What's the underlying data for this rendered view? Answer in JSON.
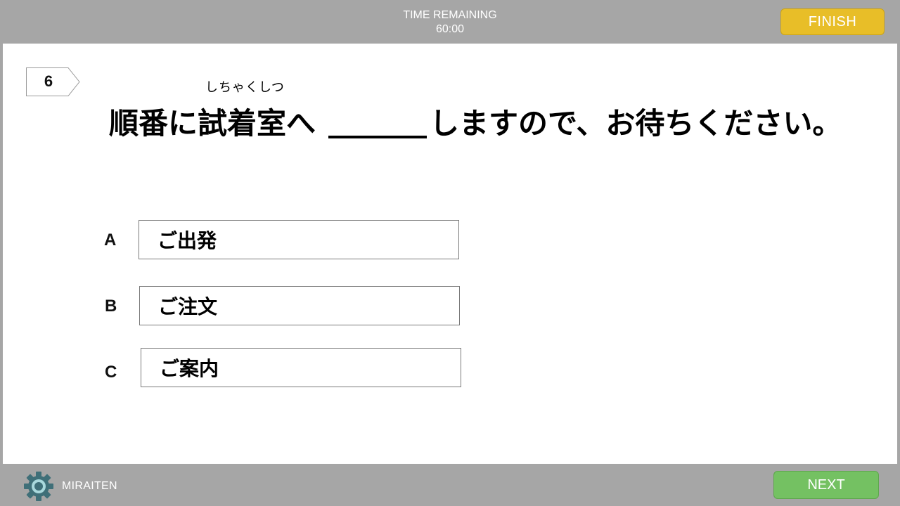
{
  "header": {
    "timer_label": "TIME REMAINING",
    "timer_value": "60:00",
    "finish_label": "FINISH"
  },
  "question": {
    "number": "6",
    "furigana": "しちゃくしつ",
    "text_before": "順番に試着室へ",
    "text_after": "しますので、お待ちください。"
  },
  "options": [
    {
      "letter": "A",
      "text": "ご出発"
    },
    {
      "letter": "B",
      "text": "ご注文"
    },
    {
      "letter": "C",
      "text": "ご案内"
    }
  ],
  "footer": {
    "brand": "MIRAITEN",
    "next_label": "NEXT",
    "logo_icon": "gear-icon"
  },
  "colors": {
    "bar": "#a6a6a6",
    "finish": "#e8be28",
    "next": "#74c162"
  }
}
